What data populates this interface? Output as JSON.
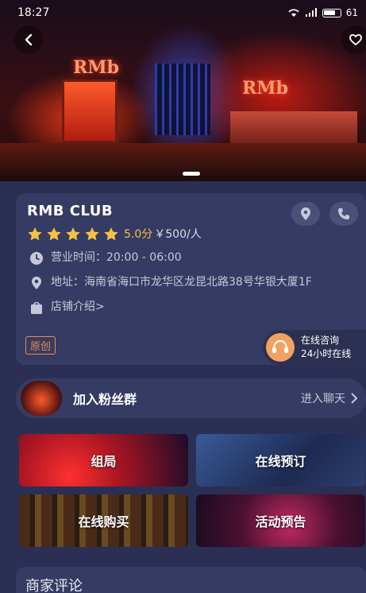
{
  "status_bar": {
    "time": "18:27",
    "battery": "61"
  },
  "hero": {
    "sign_left": "RMb",
    "sign_right": "RMb"
  },
  "shop": {
    "name": "RMB CLUB",
    "score": "5.0分",
    "price": "￥500/人",
    "hours": "营业时间：20:00 - 06:00",
    "address": "地址：海南省海口市龙华区龙昆北路38号华银大厦1F",
    "intro": "店铺介绍>",
    "badge": "原创"
  },
  "consult": {
    "line1": "在线咨询",
    "line2": "24小时在线"
  },
  "fan_group": {
    "title": "加入粉丝群",
    "enter": "进入聊天"
  },
  "tiles": [
    "组局",
    "在线预订",
    "在线购买",
    "活动预告"
  ],
  "reviews": {
    "title": "商家评论"
  },
  "colors": {
    "background": "#2b2f54",
    "card": "#363b63",
    "star": "#f5c242",
    "badge": "#e98d4a"
  },
  "icons": [
    "back-icon",
    "heart-icon",
    "location-icon",
    "phone-icon",
    "star-icon",
    "clock-icon",
    "pin-icon",
    "bag-icon",
    "chevron-right-icon"
  ]
}
